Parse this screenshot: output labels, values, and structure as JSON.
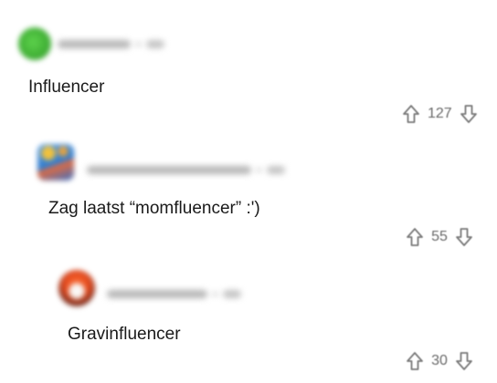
{
  "comments": [
    {
      "text": "Influencer",
      "votes": "127",
      "avatar_color": "#44b83a",
      "meta_blurred": true
    },
    {
      "text": "Zag laatst “momfluencer” :')",
      "votes": "55",
      "avatar_color": "#3a8ad6",
      "meta_blurred": true
    },
    {
      "text": "Gravinfluencer",
      "votes": "30",
      "avatar_color": "#e2502a",
      "meta_blurred": true
    }
  ],
  "icons": {
    "upvote": "upvote-arrow-icon",
    "downvote": "downvote-arrow-icon"
  },
  "colors": {
    "text": "#1a1a1a",
    "muted": "#6a6a6a",
    "icon": "#7a7a7a",
    "background": "#ffffff"
  }
}
